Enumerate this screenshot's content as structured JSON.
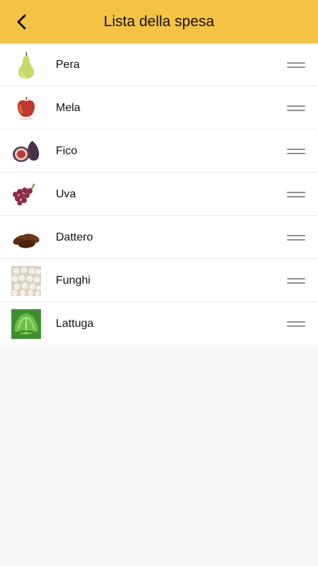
{
  "header": {
    "title": "Lista della spesa",
    "back_icon": "chevron-left-icon",
    "background_color": "#f4c343"
  },
  "items": [
    {
      "label": "Pera",
      "icon": "pear-icon"
    },
    {
      "label": "Mela",
      "icon": "apple-icon"
    },
    {
      "label": "Fico",
      "icon": "fig-icon"
    },
    {
      "label": "Uva",
      "icon": "grapes-icon"
    },
    {
      "label": "Dattero",
      "icon": "dates-icon"
    },
    {
      "label": "Funghi",
      "icon": "mushrooms-icon"
    },
    {
      "label": "Lattuga",
      "icon": "lettuce-icon"
    }
  ]
}
